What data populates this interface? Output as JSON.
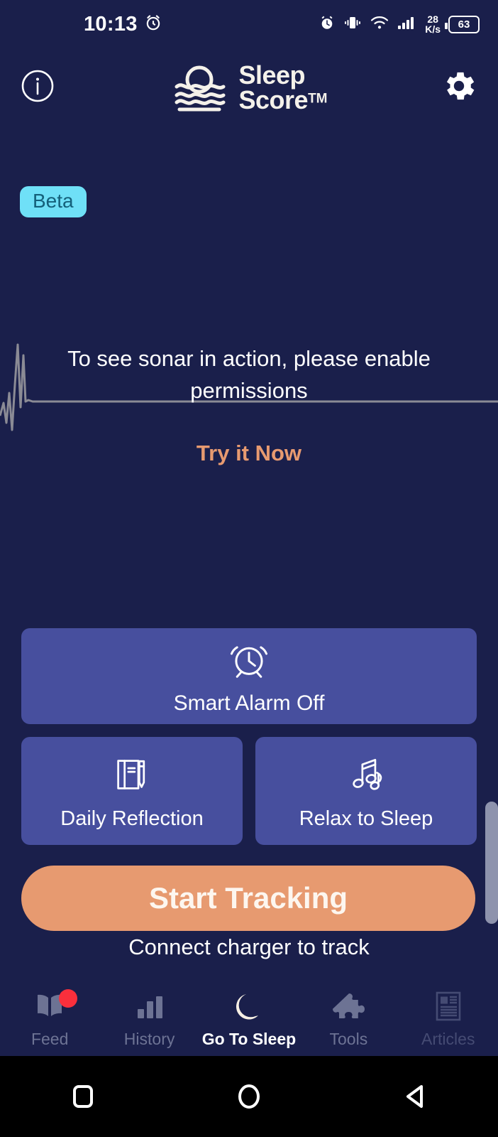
{
  "status_bar": {
    "time": "10:13",
    "alarm_icon": "alarm-clock-icon",
    "icons": [
      "alarm-icon",
      "vibrate-icon",
      "wifi-icon",
      "signal-icon"
    ],
    "network_rate_value": "28",
    "network_rate_unit": "K/s",
    "battery_level": "63"
  },
  "header": {
    "info_icon": "info-circle-icon",
    "logo_icon": "sleep-score-sun-waves-icon",
    "brand_line1": "Sleep",
    "brand_line2": "Score",
    "trademark": "TM",
    "settings_icon": "gear-icon",
    "beta_badge": "Beta"
  },
  "sonar": {
    "message": "To see sonar in action, please enable permissions",
    "cta": "Try it Now",
    "waveform_icon": "sonar-waveform-icon"
  },
  "cards": {
    "smart_alarm": {
      "label": "Smart Alarm Off",
      "icon": "alarm-clock-outline-icon"
    },
    "daily_reflection": {
      "label": "Daily Reflection",
      "icon": "journal-pen-icon"
    },
    "relax_to_sleep": {
      "label": "Relax to Sleep",
      "icon": "music-notes-icon"
    }
  },
  "tracking": {
    "button_label": "Start Tracking",
    "subtitle": "Connect charger to track"
  },
  "bottom_nav": [
    {
      "label": "Feed",
      "icon": "open-book-icon",
      "active": false,
      "badge": true
    },
    {
      "label": "History",
      "icon": "bar-chart-icon",
      "active": false,
      "badge": false
    },
    {
      "label": "Go To Sleep",
      "icon": "crescent-moon-icon",
      "active": true,
      "badge": false
    },
    {
      "label": "Tools",
      "icon": "puzzle-piece-icon",
      "active": false,
      "badge": false
    },
    {
      "label": "Articles",
      "icon": "newspaper-icon",
      "active": false,
      "badge": false
    }
  ],
  "android_nav": {
    "recents_icon": "square-recents-icon",
    "home_icon": "circle-home-icon",
    "back_icon": "triangle-back-icon"
  },
  "colors": {
    "background": "#1a1f4b",
    "card": "#474f9e",
    "accent_orange": "#e79a70",
    "beta_cyan": "#6fe0f7",
    "badge_red": "#fa2f3c"
  }
}
